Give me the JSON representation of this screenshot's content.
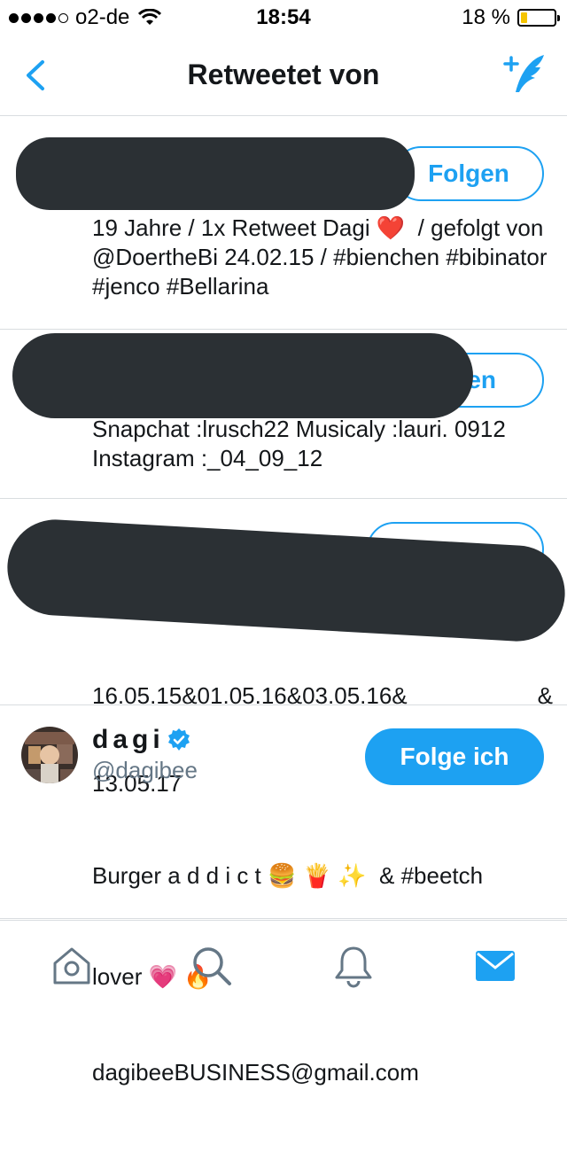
{
  "status": {
    "carrier": "o2-de",
    "time": "18:54",
    "battery": "18 %",
    "battery_level": 0.18,
    "battery_color": "#f5c400",
    "icons": [
      "signal-dots-icon",
      "wifi-icon",
      "battery-icon"
    ]
  },
  "nav": {
    "title": "Retweetet von",
    "back_icon": "chevron-left-icon",
    "compose_icon": "compose-tweet-icon"
  },
  "users": [
    {
      "name_redacted": true,
      "follow_label": "Folgen",
      "bio": "19 Jahre / 1x Retweet Dagi ❤️  / gefolgt von @DoertheBi 24.02.15 / #bienchen #bibinator #jenco #Bellarina"
    },
    {
      "name_redacted": true,
      "follow_label": "en",
      "bio": "Snapchat :lrusch22 Musicaly :lauri. 0912 Instagram :_04_09_12"
    },
    {
      "name_redacted": true,
      "follow_label": "",
      "bio_line1": "16.05.15&01.05.16&03.05.16&",
      "bio_line1_end": "&",
      "bio_line2": "13.05.17"
    },
    {
      "name": "dagi",
      "verified": true,
      "handle": "@dagibee",
      "follow_label": "Folge ich",
      "bio_line1": "Burger a d d i c t 🍔 🍟 ✨  & #beetch",
      "bio_line2": "lover 💗 🔥",
      "bio_line3": "dagibeeBUSINESS@gmail.com"
    }
  ],
  "tabs": [
    {
      "name": "home",
      "icon": "home-icon",
      "active": false
    },
    {
      "name": "search",
      "icon": "search-icon",
      "active": false
    },
    {
      "name": "notifications",
      "icon": "bell-icon",
      "active": false
    },
    {
      "name": "messages",
      "icon": "mail-icon",
      "active": true
    }
  ],
  "colors": {
    "accent": "#1da1f2",
    "text": "#14171a",
    "secondary": "#657786",
    "inactive_icon": "#657786",
    "divider": "#d9dde0",
    "redaction": "#2b3034"
  }
}
